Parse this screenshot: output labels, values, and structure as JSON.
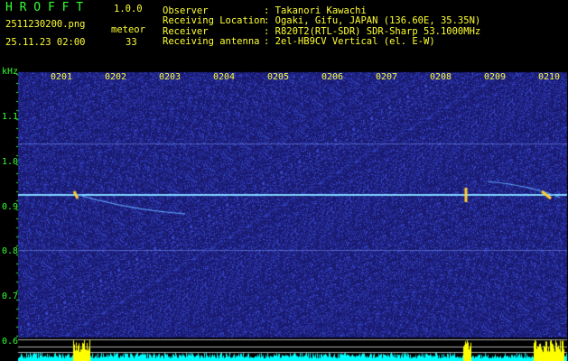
{
  "header": {
    "app_name": "H R O F F T",
    "version": "1.0.0",
    "filename": "2511230200.png",
    "meteor_label": "meteor",
    "datetime": "25.11.23 02:00",
    "meteor_count": "33",
    "info": [
      {
        "key": "Observer",
        "value": ": Takanori Kawachi"
      },
      {
        "key": "Receiving Location",
        "value": ": Ogaki, Gifu, JAPAN (136.60E, 35.35N)"
      },
      {
        "key": "Receiver",
        "value": ": R820T2(RTL-SDR) SDR-Sharp 53.1000MHz"
      },
      {
        "key": "Receiving antenna",
        "value": ": 2el-HB9CV Vertical (el. E-W)"
      }
    ]
  },
  "spectrogram": {
    "y_unit": "kHz",
    "y_ticks": [
      "1.1",
      "1.0",
      "0.9",
      "0.8",
      "0.7",
      "0.6"
    ],
    "x_ticks": [
      "0201",
      "0202",
      "0203",
      "0204",
      "0205",
      "0206",
      "0207",
      "0208",
      "0209",
      "0210"
    ],
    "colors": {
      "background": "#1a1a6e",
      "carrier": "#7fd4ff",
      "axis_text": "#33ff33",
      "time_text": "#ffff33",
      "power_bar": "#00ffff",
      "peak": "#ffff00"
    }
  }
}
